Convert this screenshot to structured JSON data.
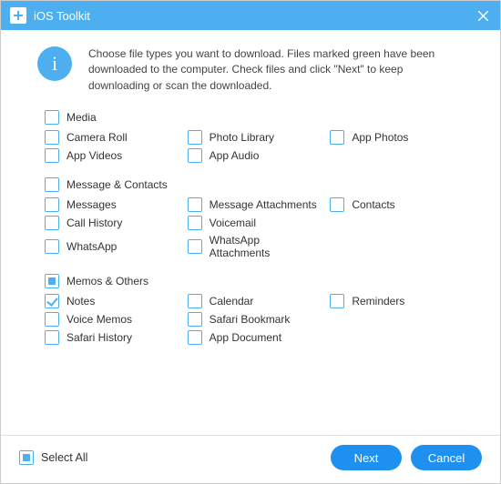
{
  "titlebar": {
    "title": "iOS Toolkit"
  },
  "info": {
    "text": "Choose file types you want to download. Files marked green have been downloaded to the computer. Check files and click \"Next\" to keep downloading or scan the downloaded."
  },
  "groups": [
    {
      "header": {
        "label": "Media",
        "state": "unchecked"
      },
      "rows": [
        [
          {
            "label": "Camera Roll",
            "state": "unchecked"
          },
          {
            "label": "Photo Library",
            "state": "unchecked"
          },
          {
            "label": "App Photos",
            "state": "unchecked"
          }
        ],
        [
          {
            "label": "App Videos",
            "state": "unchecked"
          },
          {
            "label": "App Audio",
            "state": "unchecked"
          },
          null
        ]
      ]
    },
    {
      "header": {
        "label": "Message & Contacts",
        "state": "unchecked"
      },
      "rows": [
        [
          {
            "label": "Messages",
            "state": "unchecked"
          },
          {
            "label": "Message Attachments",
            "state": "unchecked"
          },
          {
            "label": "Contacts",
            "state": "unchecked"
          }
        ],
        [
          {
            "label": "Call History",
            "state": "unchecked"
          },
          {
            "label": "Voicemail",
            "state": "unchecked"
          },
          null
        ],
        [
          {
            "label": "WhatsApp",
            "state": "unchecked"
          },
          {
            "label": "WhatsApp Attachments",
            "state": "unchecked"
          },
          null
        ]
      ]
    },
    {
      "header": {
        "label": "Memos & Others",
        "state": "indeterminate"
      },
      "rows": [
        [
          {
            "label": "Notes",
            "state": "checked"
          },
          {
            "label": "Calendar",
            "state": "unchecked"
          },
          {
            "label": "Reminders",
            "state": "unchecked"
          }
        ],
        [
          {
            "label": "Voice Memos",
            "state": "unchecked"
          },
          {
            "label": "Safari Bookmark",
            "state": "unchecked"
          },
          null
        ],
        [
          {
            "label": "Safari History",
            "state": "unchecked"
          },
          {
            "label": "App Document",
            "state": "unchecked"
          },
          null
        ]
      ]
    }
  ],
  "footer": {
    "select_all": {
      "label": "Select All",
      "state": "indeterminate"
    },
    "next": "Next",
    "cancel": "Cancel"
  }
}
